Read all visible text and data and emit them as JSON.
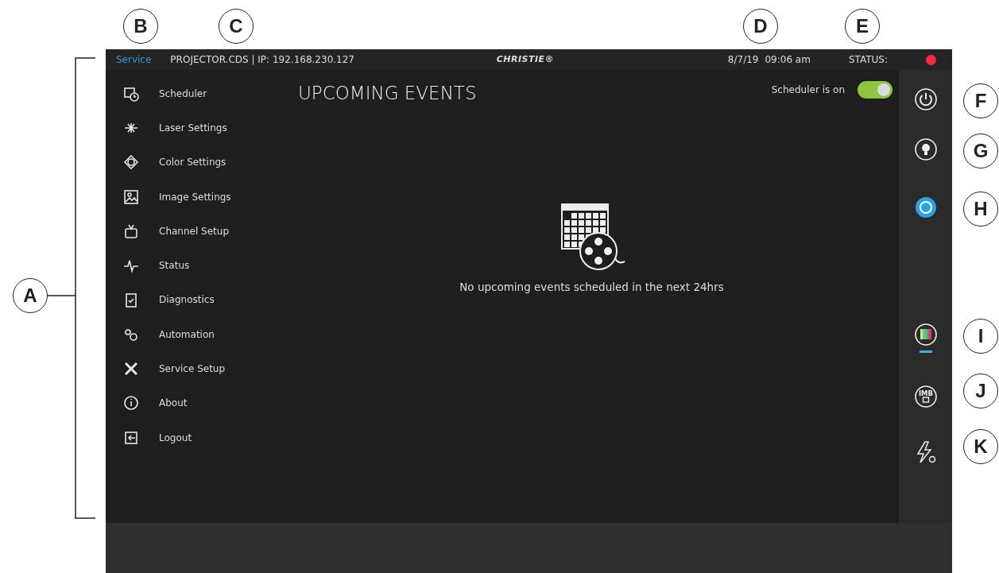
{
  "callouts": {
    "left": "A",
    "top": [
      "B",
      "C",
      "D",
      "E"
    ],
    "right": [
      "F",
      "G",
      "H",
      "I",
      "J",
      "K"
    ]
  },
  "header": {
    "mode": "Service",
    "device": "PROJECTOR.CDS | IP: 192.168.230.127",
    "logo": "CHRISTIE®",
    "date": "8/7/19",
    "time": "09:06 am",
    "status_label": "STATUS:",
    "status_indicator": {
      "color": "#ff2a3a"
    }
  },
  "sidebar": {
    "items": [
      {
        "label": "Scheduler",
        "kind": "scheduler"
      },
      {
        "label": "Laser Settings",
        "kind": "laser"
      },
      {
        "label": "Color Settings",
        "kind": "color"
      },
      {
        "label": "Image Settings",
        "kind": "image"
      },
      {
        "label": "Channel Setup",
        "kind": "channel"
      },
      {
        "label": "Status",
        "kind": "status"
      },
      {
        "label": "Diagnostics",
        "kind": "diagnostics"
      },
      {
        "label": "Automation",
        "kind": "automation"
      },
      {
        "label": "Service Setup",
        "kind": "service"
      },
      {
        "label": "About",
        "kind": "about"
      },
      {
        "label": "Logout",
        "kind": "logout"
      }
    ]
  },
  "main": {
    "title": "UPCOMING EVENTS",
    "toggle": {
      "label": "Scheduler is on",
      "on": true
    },
    "empty_message": "No upcoming events scheduled in the next 24hrs"
  },
  "rail": [
    {
      "kind": "power",
      "selected": false,
      "underline": false
    },
    {
      "kind": "lamp",
      "selected": false,
      "underline": false
    },
    {
      "kind": "shutter",
      "selected": true,
      "underline": false
    },
    {
      "kind": "test-pattern",
      "selected": false,
      "underline": true
    },
    {
      "kind": "imb",
      "selected": false,
      "underline": false,
      "text": "IMB"
    },
    {
      "kind": "lightning",
      "selected": false,
      "underline": false
    }
  ]
}
